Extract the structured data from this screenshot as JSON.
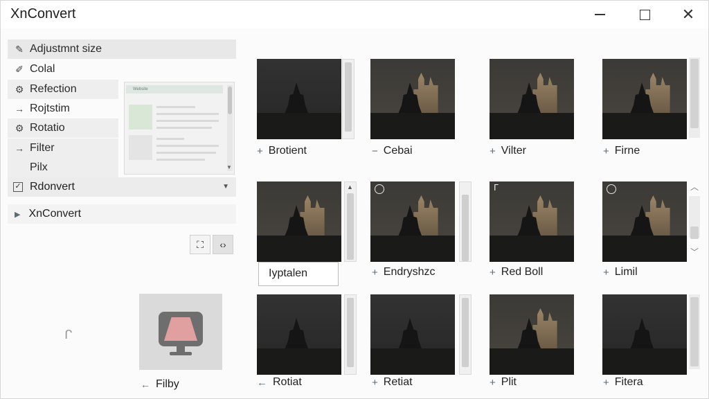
{
  "window": {
    "title": "XnConvert",
    "controls": {
      "minimize": "minimize",
      "maximize": "maximize",
      "close": "✕"
    }
  },
  "left_panel": {
    "tasks": [
      {
        "label": "Adjustmnt size",
        "icon": "pencil-check-icon"
      },
      {
        "label": "Colal",
        "icon": "brush-icon"
      },
      {
        "label": "Refection",
        "icon": "gear-icon"
      },
      {
        "label": "Rojtstim",
        "icon": "arrow-right-icon"
      },
      {
        "label": "Rotatio",
        "icon": "gear-icon"
      },
      {
        "label": "Filter",
        "icon": "arrow-right-icon"
      },
      {
        "label": "Pilx",
        "icon": ""
      }
    ],
    "preview_popup": {
      "header": "Website"
    },
    "convert_option": {
      "label": "Rdonvert",
      "checked": true
    },
    "nav_item": {
      "label": "XnConvert"
    },
    "tools": {
      "crop": "crop-icon",
      "code": "code-icon"
    },
    "small_glyph": "ᒋ",
    "monitor_tile": {
      "label": "Filby",
      "icon": "monitor-icon"
    }
  },
  "grid": {
    "tiles": [
      {
        "caption": "Brotient",
        "marker": "+",
        "tone": "dark"
      },
      {
        "caption": "Cebai",
        "marker": "−",
        "tone": "warm"
      },
      {
        "caption": "Vilter",
        "marker": "+",
        "tone": "warm"
      },
      {
        "caption": "Firne",
        "marker": "+",
        "tone": "warm"
      },
      {
        "caption": "Endryshzc",
        "marker": "+",
        "tone": "warm"
      },
      {
        "caption": "Red Boll",
        "marker": "+",
        "tone": "warm"
      },
      {
        "caption": "Limil",
        "marker": "+",
        "tone": "warm"
      },
      {
        "caption": "Rotiat",
        "marker": "←",
        "tone": "dark"
      },
      {
        "caption": "Retiat",
        "marker": "+",
        "tone": "dark"
      },
      {
        "caption": "Plit",
        "marker": "+",
        "tone": "warm"
      },
      {
        "caption": "Fitera",
        "marker": "+",
        "tone": "dark"
      }
    ],
    "name_field": "Iyptalen"
  }
}
